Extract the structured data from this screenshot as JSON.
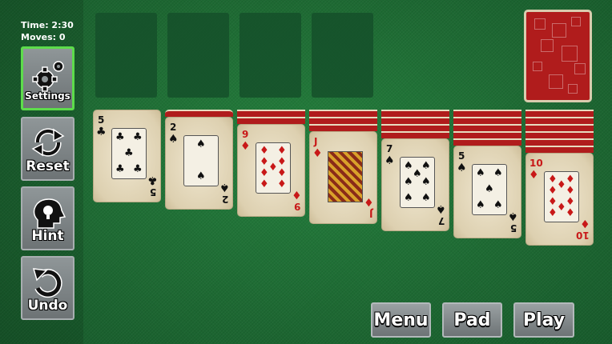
{
  "status": {
    "time": "Time: 2:30",
    "moves": "Moves: 0"
  },
  "sidebar": {
    "settings_label": "Settings",
    "reset_label": "Reset",
    "hint_label": "Hint",
    "undo_label": "Undo"
  },
  "bottom": {
    "menu_label": "Menu",
    "pad_label": "Pad",
    "play_label": "Play"
  },
  "foundations": [
    "",
    "",
    "",
    ""
  ],
  "stock": {
    "face": "down",
    "color": "#b01c1c"
  },
  "tableau": [
    {
      "hidden": 0,
      "rank": "5",
      "suit": "♣",
      "color": "black"
    },
    {
      "hidden": 1,
      "rank": "2",
      "suit": "♠",
      "color": "black"
    },
    {
      "hidden": 2,
      "rank": "9",
      "suit": "♦",
      "color": "red"
    },
    {
      "hidden": 3,
      "rank": "J",
      "suit": "♦",
      "color": "red"
    },
    {
      "hidden": 4,
      "rank": "7",
      "suit": "♠",
      "color": "black"
    },
    {
      "hidden": 5,
      "rank": "5",
      "suit": "♠",
      "color": "black"
    },
    {
      "hidden": 6,
      "rank": "10",
      "suit": "♦",
      "color": "red"
    }
  ],
  "colors": {
    "felt": "#1f6b35",
    "card_back": "#b01c1c",
    "active_border": "#5ddc4b"
  }
}
